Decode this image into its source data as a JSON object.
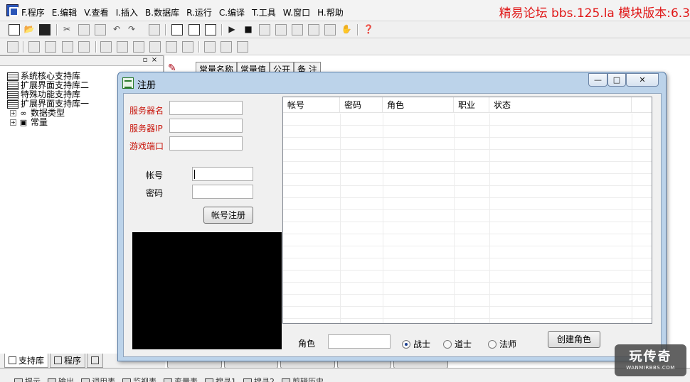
{
  "ide": {
    "menus": [
      "F.程序",
      "E.编辑",
      "V.查看",
      "I.插入",
      "B.数据库",
      "R.运行",
      "C.编译",
      "T.工具",
      "W.窗口",
      "H.帮助"
    ],
    "banner": "精易论坛 bbs.125.la 模块版本:6.3",
    "tree": {
      "items": [
        {
          "label": "系统核心支持库",
          "icon": "book-icon"
        },
        {
          "label": "扩展界面支持库二",
          "icon": "book-icon"
        },
        {
          "label": "特殊功能支持库",
          "icon": "book-icon"
        },
        {
          "label": "扩展界面支持库一",
          "icon": "book-icon"
        },
        {
          "label": "数据类型",
          "icon": "datatype-icon",
          "expandable": true
        },
        {
          "label": "常量",
          "icon": "constant-icon",
          "expandable": true
        }
      ]
    },
    "left_tabs": [
      "支持库",
      "程序"
    ],
    "const_header": [
      "常量名称",
      "常量值",
      "公开",
      "备 注"
    ],
    "bottom_items": [
      "提示",
      "输出",
      "调用表",
      "监视表",
      "变量表",
      "搜寻1",
      "搜寻2",
      "剪辑历史"
    ]
  },
  "dialog": {
    "title": "注册",
    "server": {
      "name_label": "服务器名",
      "ip_label": "服务器IP",
      "port_label": "游戏端口",
      "name_value": "",
      "ip_value": "",
      "port_value": ""
    },
    "account": {
      "account_label": "帐号",
      "password_label": "密码",
      "account_value": "",
      "password_value": "",
      "register_button": "帐号注册"
    },
    "list": {
      "columns": [
        "帐号",
        "密码",
        "角色",
        "职业",
        "状态"
      ],
      "rows": []
    },
    "role": {
      "label": "角色",
      "value": "",
      "options": [
        "战士",
        "道士",
        "法师"
      ],
      "selected": "战士",
      "create_button": "创建角色"
    }
  },
  "watermark": {
    "big": "玩传奇",
    "small": "WANMIRBBS.COM"
  }
}
